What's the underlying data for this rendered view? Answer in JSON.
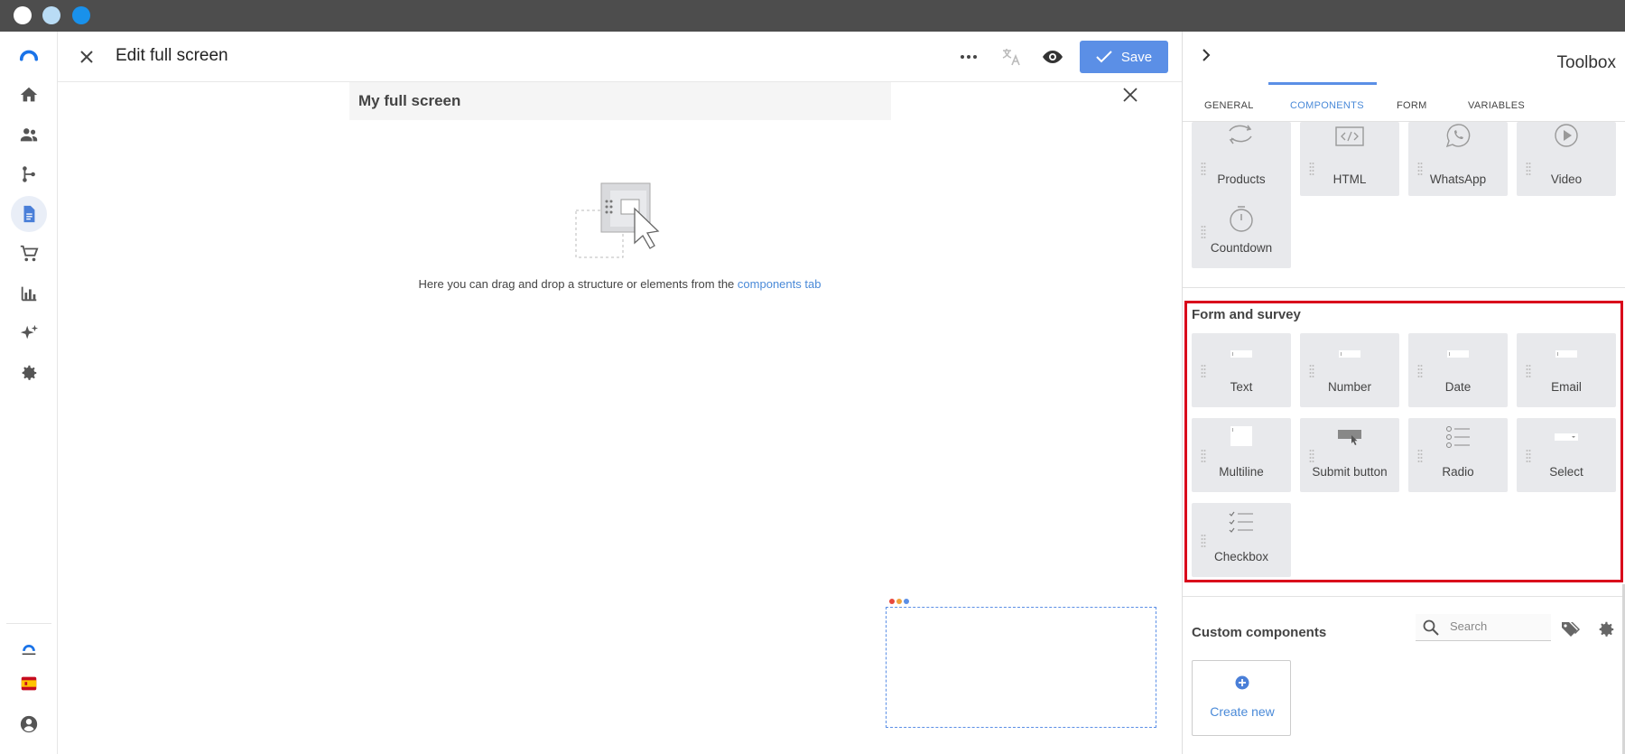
{
  "window": {
    "traffic_light_colors": [
      "#ffffff",
      "#b9dcf5",
      "#1991eb"
    ]
  },
  "leftnav": {
    "items": [
      {
        "icon": "logo-icon"
      },
      {
        "icon": "home-icon"
      },
      {
        "icon": "users-icon"
      },
      {
        "icon": "flow-icon"
      },
      {
        "icon": "document-icon"
      },
      {
        "icon": "cart-icon"
      },
      {
        "icon": "bar-chart-icon"
      },
      {
        "icon": "sparkle-icon"
      },
      {
        "icon": "gear-icon"
      }
    ],
    "bottom": [
      {
        "icon": "brand-logo-icon"
      },
      {
        "icon": "spain-flag-icon"
      },
      {
        "icon": "account-circle-icon"
      }
    ]
  },
  "header": {
    "title": "Edit full screen",
    "save_label": "Save",
    "save_color": "#5b8fe6"
  },
  "canvas": {
    "screen_title": "My full screen",
    "drop_text": "Here you can drag and drop a structure or elements from the",
    "drop_link": "components tab"
  },
  "toolbox": {
    "title": "Toolbox",
    "tabs": [
      "GENERAL",
      "COMPONENTS",
      "FORM",
      "VARIABLES"
    ],
    "active_tab": "COMPONENTS",
    "top_components": [
      {
        "label": "Products",
        "icon": "products-icon"
      },
      {
        "label": "HTML",
        "icon": "html-icon"
      },
      {
        "label": "WhatsApp",
        "icon": "whatsapp-icon"
      },
      {
        "label": "Video",
        "icon": "video-icon"
      },
      {
        "label": "Countdown",
        "icon": "stopwatch-icon"
      }
    ],
    "form_section_title": "Form and survey",
    "form_components": [
      {
        "label": "Text",
        "icon": "text-field-icon"
      },
      {
        "label": "Number",
        "icon": "number-field-icon"
      },
      {
        "label": "Date",
        "icon": "date-field-icon"
      },
      {
        "label": "Email",
        "icon": "email-field-icon"
      },
      {
        "label": "Multiline",
        "icon": "multiline-field-icon"
      },
      {
        "label": "Submit button",
        "icon": "submit-button-icon"
      },
      {
        "label": "Radio",
        "icon": "radio-list-icon"
      },
      {
        "label": "Select",
        "icon": "select-field-icon"
      },
      {
        "label": "Checkbox",
        "icon": "checkbox-list-icon"
      }
    ],
    "custom_section_title": "Custom components",
    "search_placeholder": "Search",
    "create_new_label": "Create new",
    "highlight_color": "#d9001b",
    "link_color": "#4a8ad8"
  }
}
